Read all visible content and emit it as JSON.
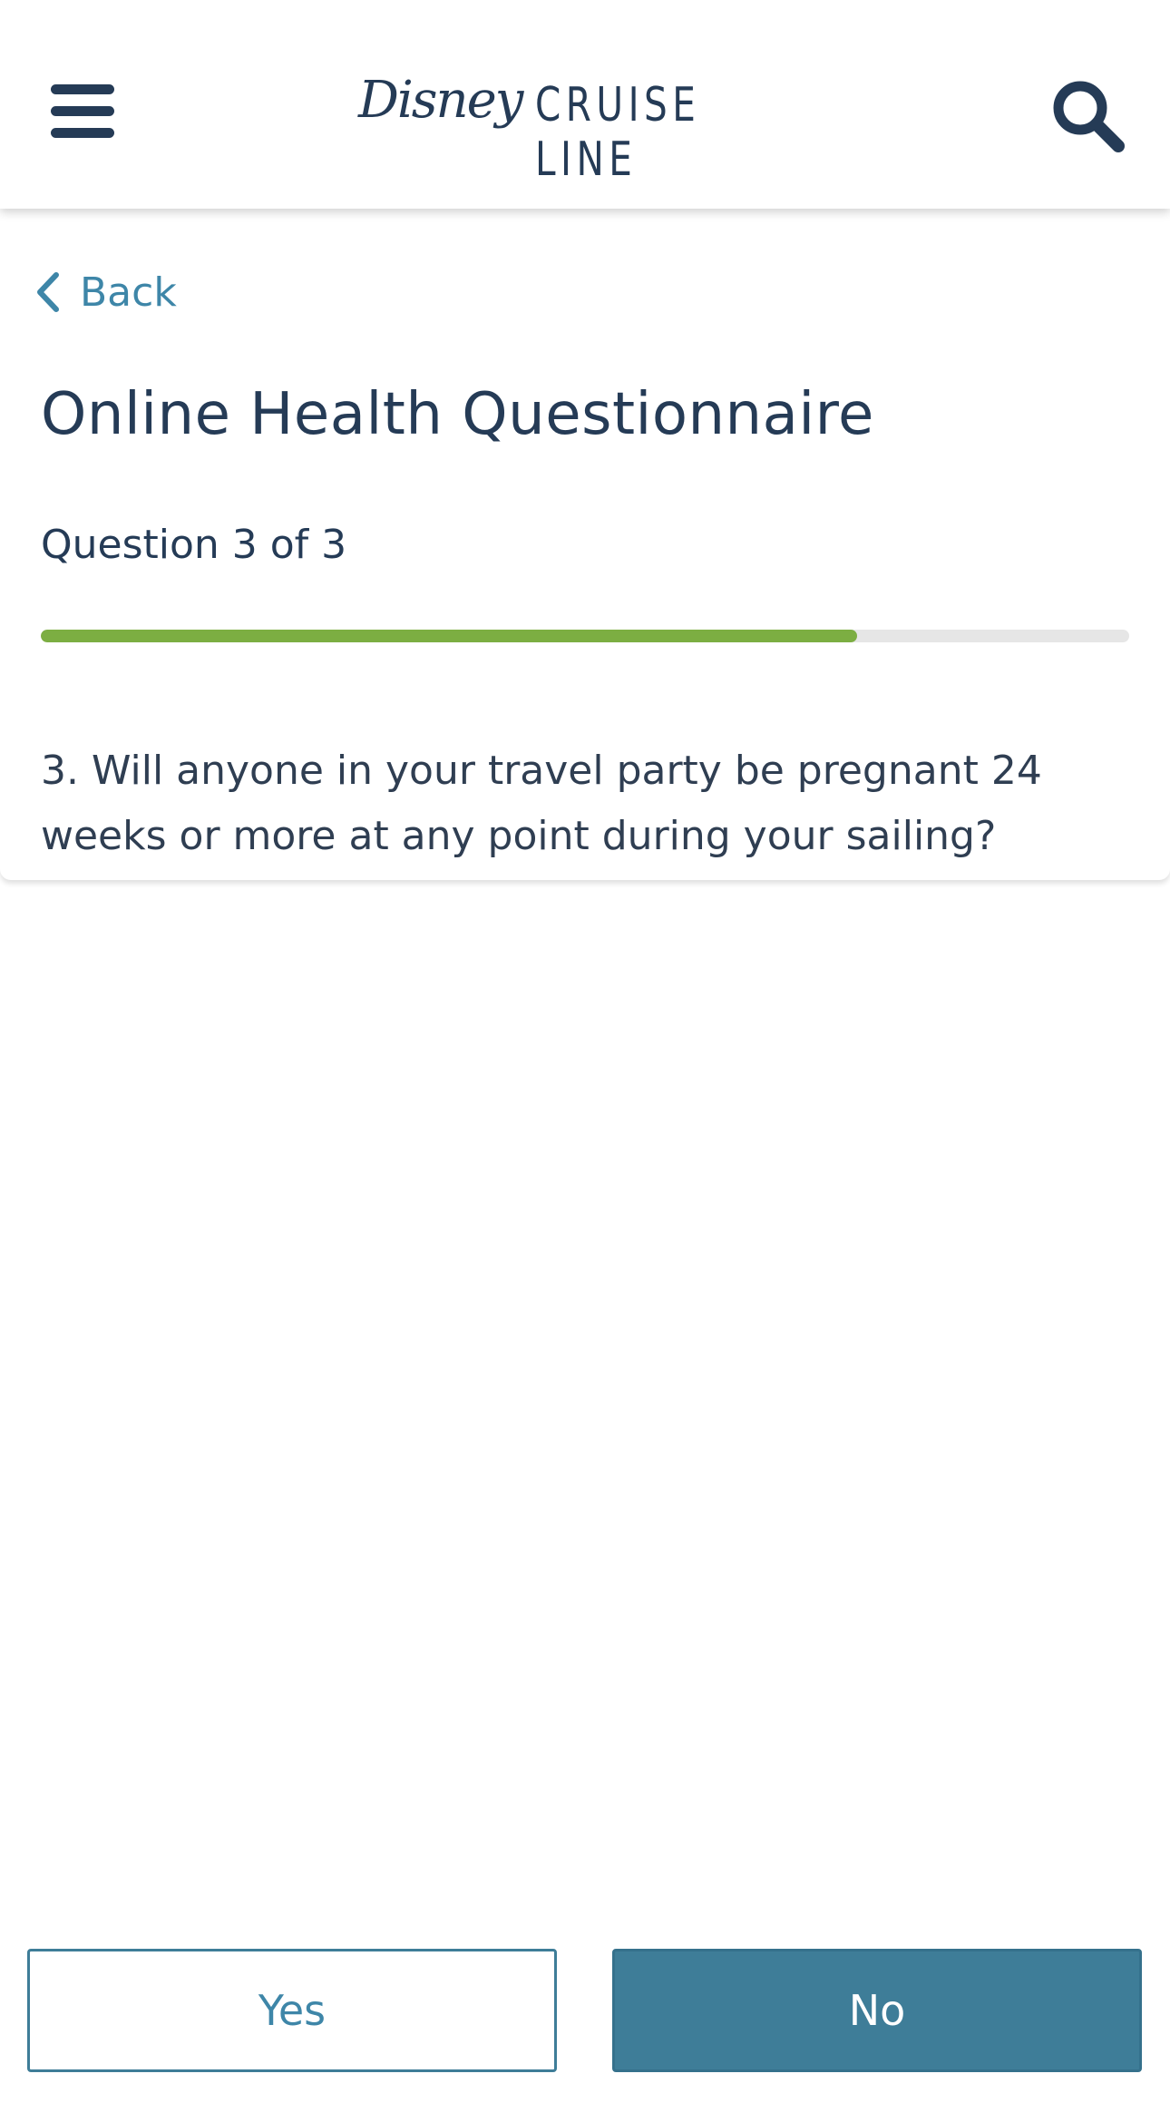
{
  "header": {
    "menu_icon": "hamburger-menu-icon",
    "logo": {
      "script_text": "Disney",
      "word_text": "CRUISE LINE"
    },
    "search_icon": "search-icon"
  },
  "nav": {
    "back_icon": "chevron-left-icon",
    "back_label": "Back"
  },
  "page": {
    "title": "Online Health Questionnaire",
    "question_counter": "Question 3 of 3",
    "progress_percent": 75,
    "question_text": "3. Will anyone in your travel party be pregnant 24 weeks or more at any point during your sailing?"
  },
  "actions": {
    "yes_label": "Yes",
    "no_label": "No"
  },
  "colors": {
    "navy": "#253b56",
    "link_blue": "#3e86a8",
    "button_teal": "#3e7d98",
    "progress_green": "#7cae42",
    "progress_track": "#e6e6e6"
  }
}
